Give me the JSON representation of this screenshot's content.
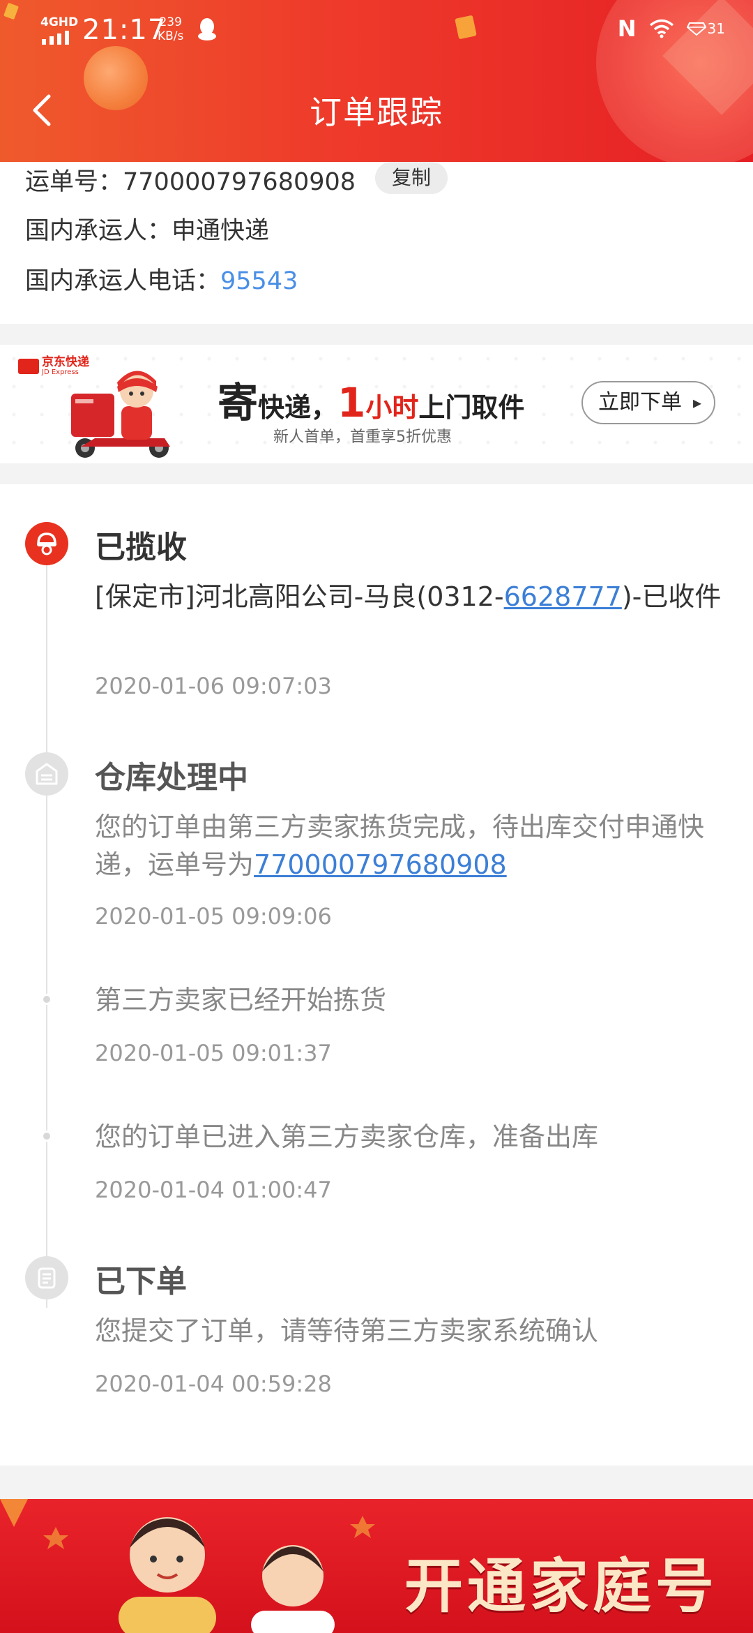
{
  "status_bar": {
    "network": "4GHD",
    "time": "21:17",
    "speed_value": "239",
    "speed_unit": "KB/s",
    "nfc": "N",
    "battery": "31"
  },
  "nav": {
    "title": "订单跟踪"
  },
  "waybill": {
    "number_label": "运单号：",
    "number_value": "770000797680908",
    "copy_label": "复制",
    "carrier_label": "国内承运人：",
    "carrier_value": "申通快递",
    "phone_label": "国内承运人电话：",
    "phone_value": "95543"
  },
  "banner": {
    "logo": "京东快递",
    "logo_sub": "JD Express",
    "headline_a": "寄",
    "headline_b": "快递，",
    "headline_c": "1",
    "headline_d": "小时",
    "headline_e": "上门取件",
    "subline": "新人首单，首重享5折优惠",
    "cta": "立即下单"
  },
  "timeline": {
    "events": [
      {
        "status": "已揽收",
        "desc_prefix": "[保定市]河北高阳公司-马良(0312-",
        "desc_link": "6628777",
        "desc_suffix": ")-已收件",
        "time": "2020-01-06 09:07:03"
      },
      {
        "status": "仓库处理中",
        "desc_prefix": "您的订单由第三方卖家拣货完成，待出库交付申通快递，运单号为",
        "desc_link": "770000797680908",
        "time": "2020-01-05 09:09:06"
      },
      {
        "desc": "第三方卖家已经开始拣货",
        "time": "2020-01-05 09:01:37"
      },
      {
        "desc": "您的订单已进入第三方卖家仓库，准备出库",
        "time": "2020-01-04 01:00:47"
      },
      {
        "status": "已下单",
        "desc": "您提交了订单，请等待第三方卖家系统确认",
        "time": "2020-01-04 00:59:28"
      }
    ]
  },
  "promo": {
    "title": "开通家庭号"
  },
  "colors": {
    "brand_red": "#e8321f",
    "link_blue": "#3c7fd6"
  }
}
